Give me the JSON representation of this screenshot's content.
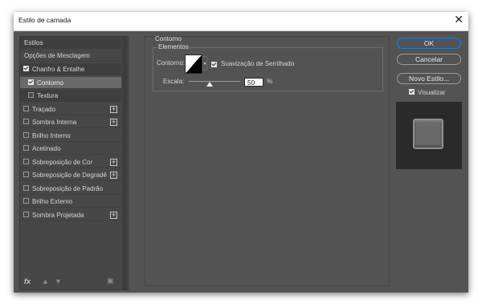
{
  "title": "Estilo de camada",
  "left_panel": {
    "items": [
      {
        "label": "Estilos"
      },
      {
        "label": "Opções de Mesclagem"
      },
      {
        "label": "Chanfro & Entalhe",
        "checked": true
      },
      {
        "label": "Contorno",
        "checked": true,
        "selected": true
      },
      {
        "label": "Textura",
        "checked": false
      },
      {
        "label": "Traçado",
        "checked": false,
        "plus": true
      },
      {
        "label": "Sombra Interna",
        "checked": false,
        "plus": true
      },
      {
        "label": "Brilho Interno",
        "checked": false
      },
      {
        "label": "Acetinado",
        "checked": false
      },
      {
        "label": "Sobreposição de Cor",
        "checked": false,
        "plus": true
      },
      {
        "label": "Sobreposição de Degradê",
        "checked": false,
        "plus": true
      },
      {
        "label": "Sobreposição de Padrão",
        "checked": false
      },
      {
        "label": "Brilho Externo",
        "checked": false
      },
      {
        "label": "Sombra Projetada",
        "checked": false,
        "plus": true
      }
    ],
    "footer": {
      "fx": "fx"
    }
  },
  "contour": {
    "group_title": "Contorno",
    "fieldset_title": "Elementos",
    "contour_label": "Contorno:",
    "antialias_label": "Suavização de Serrilhado",
    "antialias_checked": true,
    "range_label": "Escala:",
    "range_value": "50",
    "range_unit": "%"
  },
  "buttons": {
    "ok": "OK",
    "cancel": "Cancelar",
    "new_style": "Novo Estilo...",
    "preview_label": "Visualizar",
    "preview_checked": true
  }
}
